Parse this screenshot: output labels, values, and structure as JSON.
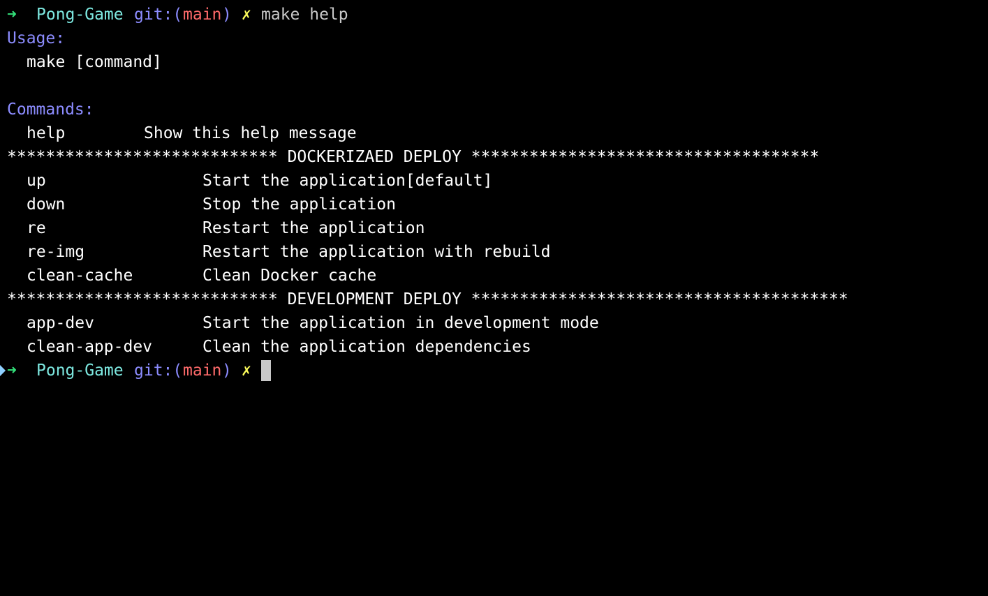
{
  "colors": {
    "background": "#000000",
    "prompt_arrow": "#33e07a",
    "directory": "#7de8e0",
    "git_label": "#8c8cff",
    "branch": "#ff6a6a",
    "dirty_marker": "#ffff5c",
    "typed_command": "#c8c8c8",
    "heading": "#8c8cff",
    "text": "#ffffff",
    "cursor": "#c8c8c8"
  },
  "icons": {
    "prompt_arrow": "right-arrow-icon",
    "dirty_marker": "x-mark-icon",
    "edge_marker": "triangle-right-icon",
    "cursor": "block-cursor"
  },
  "prompt": {
    "arrow": "➜",
    "directory": "Pong-Game",
    "git_label": "git:(",
    "branch": "main",
    "git_close": ")",
    "dirty": "✗",
    "command": "make help"
  },
  "usage": {
    "heading": "Usage:",
    "syntax": "make [command]"
  },
  "commands": {
    "heading": "Commands:",
    "help": {
      "name": "help",
      "description": "Show this help message"
    }
  },
  "sections": [
    {
      "banner": "**************************** DOCKERIZAED DEPLOY ************************************",
      "items": [
        {
          "name": "up",
          "description": "Start the application[default]"
        },
        {
          "name": "down",
          "description": "Stop the application"
        },
        {
          "name": "re",
          "description": "Restart the application"
        },
        {
          "name": "re-img",
          "description": "Restart the application with rebuild"
        },
        {
          "name": "clean-cache",
          "description": "Clean Docker cache"
        }
      ]
    },
    {
      "banner": "**************************** DEVELOPMENT DEPLOY ***************************************",
      "items": [
        {
          "name": "app-dev",
          "description": "Start the application in development mode"
        },
        {
          "name": "clean-app-dev",
          "description": "Clean the application dependencies"
        }
      ]
    }
  ],
  "next_prompt": {
    "arrow": "➜",
    "directory": "Pong-Game",
    "git_label": "git:(",
    "branch": "main",
    "git_close": ")",
    "dirty": "✗"
  }
}
